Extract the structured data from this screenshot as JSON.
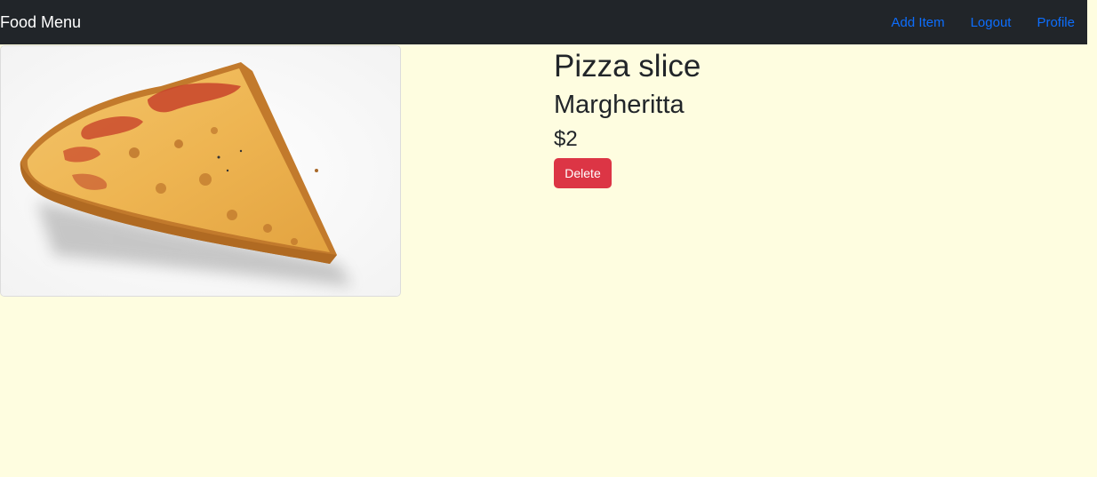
{
  "navbar": {
    "brand": "Food Menu",
    "links": [
      "Add Item",
      "Logout",
      "Profile"
    ]
  },
  "item": {
    "name": "Pizza slice",
    "type": "Margheritta",
    "price": "$2",
    "image_icon": "pizza-slice-photo"
  },
  "actions": {
    "delete_label": "Delete"
  },
  "colors": {
    "page_bg": "#fefde0",
    "navbar_bg": "#212529",
    "link": "#0d6efd",
    "danger": "#dc3545"
  }
}
